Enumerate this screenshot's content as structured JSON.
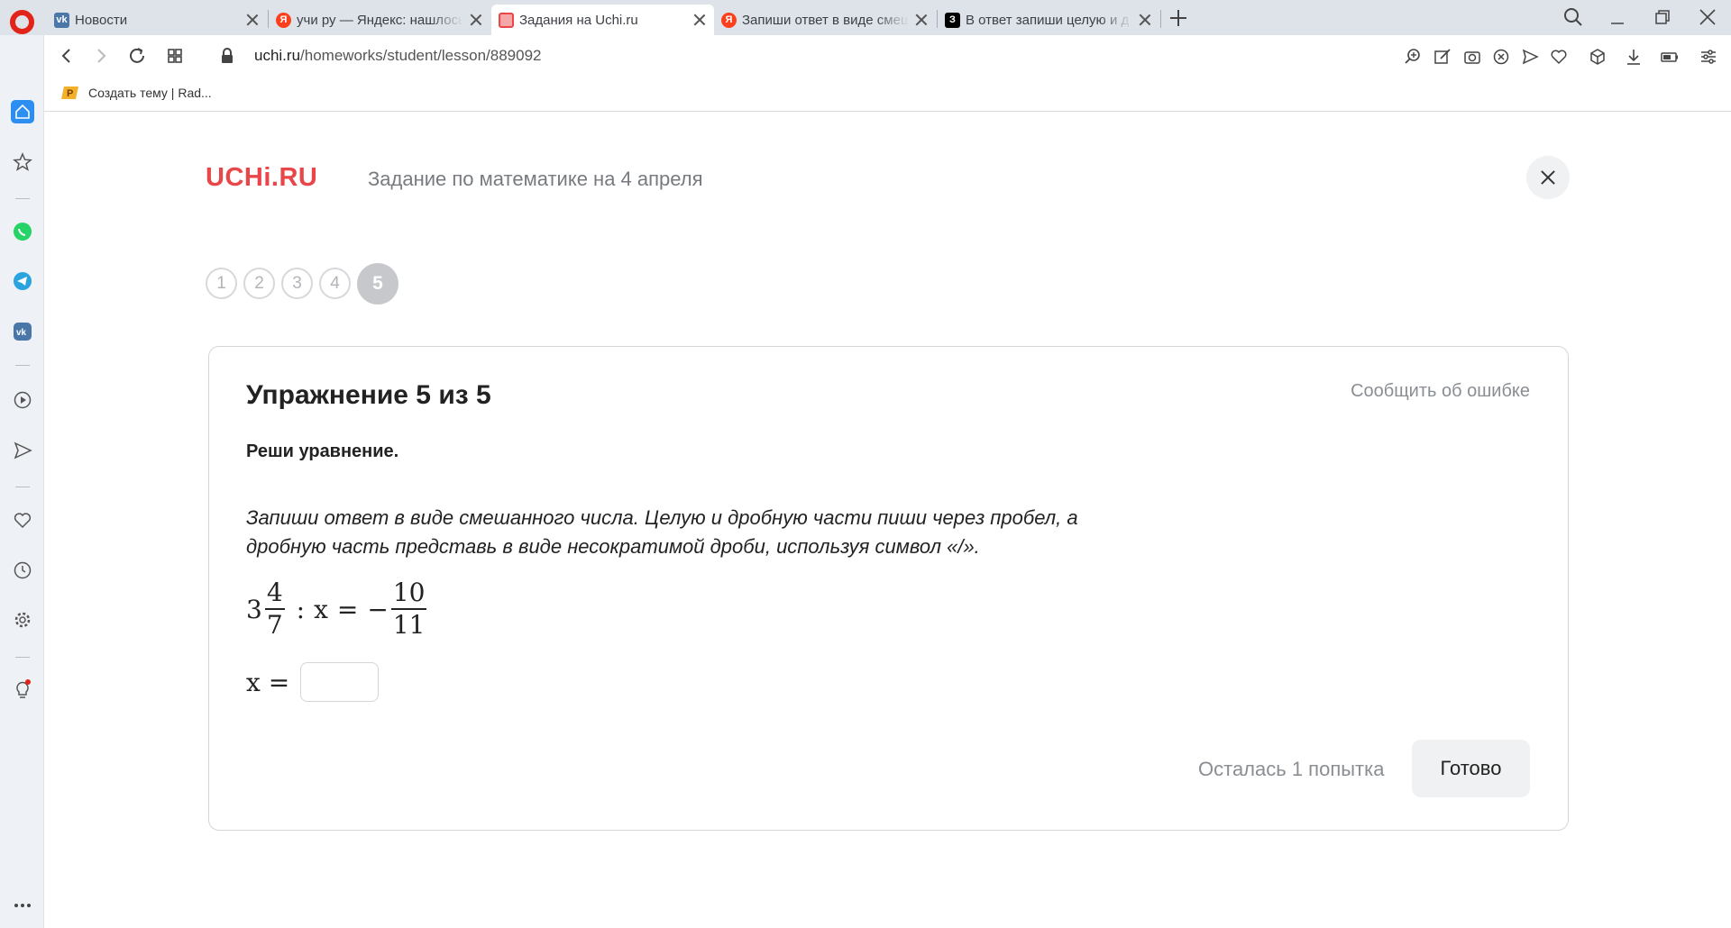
{
  "browser": {
    "tabs": [
      {
        "label": "Новости",
        "favicon": "vk-icon",
        "color": "#4a76a8",
        "glyph": "vk",
        "active": false
      },
      {
        "label": "учи ру — Яндекс: нашлось",
        "favicon": "yandex-icon",
        "color": "#fc3f1d",
        "glyph": "Я",
        "active": false
      },
      {
        "label": "Задания на Uchi.ru",
        "favicon": "uchi-icon",
        "color": "#e9464a",
        "glyph": "",
        "active": true
      },
      {
        "label": "Запиши ответ в виде смеш",
        "favicon": "yandex-icon",
        "color": "#fc3f1d",
        "glyph": "Я",
        "active": false
      },
      {
        "label": "В ответ запиши целую и д",
        "favicon": "znanija-icon",
        "color": "#000000",
        "glyph": "З",
        "active": false
      }
    ],
    "url_host": "uchi.ru",
    "url_path": "/homeworks/student/lesson/889092",
    "bookmark": "Создать тему | Rad..."
  },
  "page": {
    "logo": "UCHi.RU",
    "lesson_title": "Задание по математике на 4 апреля",
    "steps": [
      "1",
      "2",
      "3",
      "4",
      "5"
    ],
    "current_step": "5"
  },
  "exercise": {
    "title": "Упражнение 5 из 5",
    "report_label": "Сообщить об ошибке",
    "task": "Реши уравнение.",
    "instruction": "Запиши ответ в виде смешанного числа. Целую и дробную части пиши через пробел, а дробную часть представь в виде несократимой дроби, используя символ «/».",
    "equation": {
      "whole": "3",
      "num1": "4",
      "den1": "7",
      "op": ":",
      "var": "x",
      "eq": "=",
      "minus": "−",
      "num2": "10",
      "den2": "11"
    },
    "answer_label": "x =",
    "answer_value": "",
    "attempts_label": "Осталась 1 попытка",
    "done_label": "Готово"
  },
  "colors": {
    "brand": "#e9464a",
    "opera": "#e2231a",
    "sidebar_active": "#2b8ef0"
  }
}
